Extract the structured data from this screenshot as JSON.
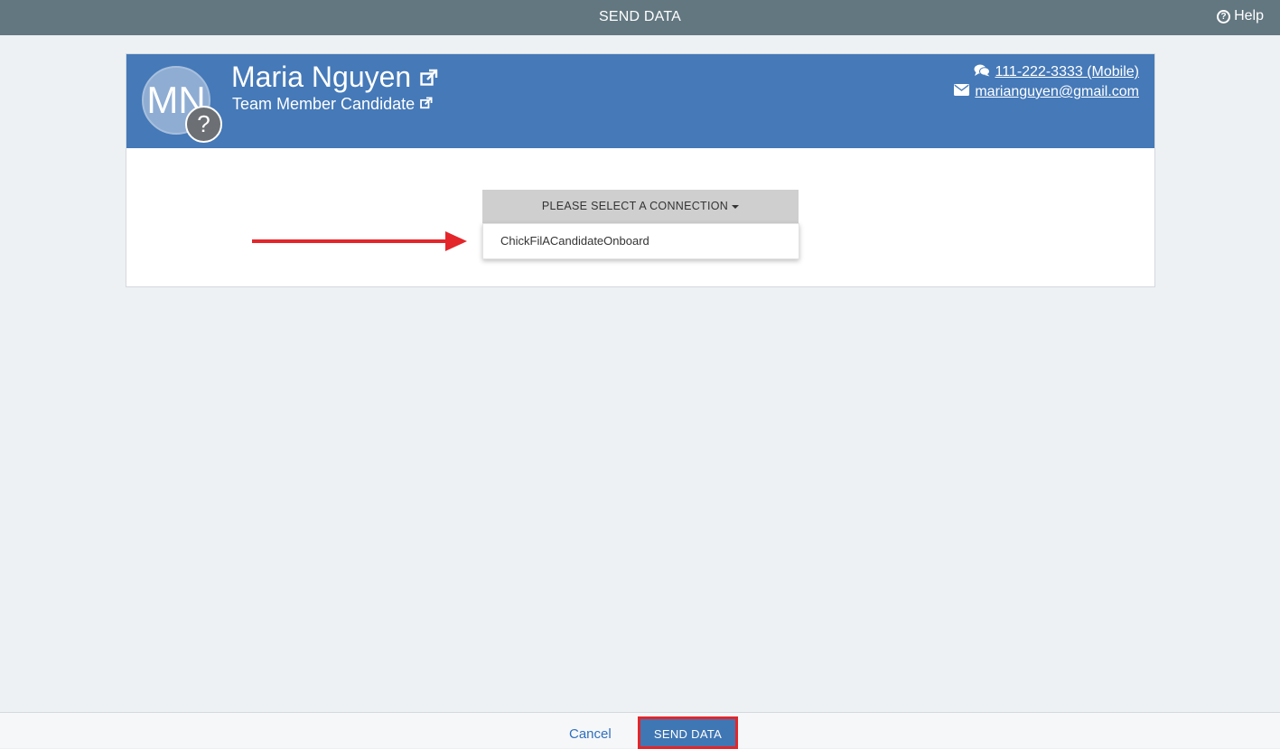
{
  "header": {
    "title": "SEND DATA",
    "help_label": "Help"
  },
  "profile": {
    "initials": "MN",
    "badge": "?",
    "name": "Maria Nguyen",
    "role": "Team Member Candidate",
    "phone": "111-222-3333 (Mobile)",
    "email": "marianguyen@gmail.com"
  },
  "connection": {
    "toggle_label": "PLEASE SELECT A CONNECTION",
    "options": [
      "ChickFilACandidateOnboard"
    ]
  },
  "footer": {
    "cancel_label": "Cancel",
    "send_label": "SEND DATA"
  },
  "colors": {
    "topbar": "#637780",
    "card_header": "#4579b8",
    "annotation_red": "#e3262a",
    "primary_button": "#3f76b4"
  }
}
